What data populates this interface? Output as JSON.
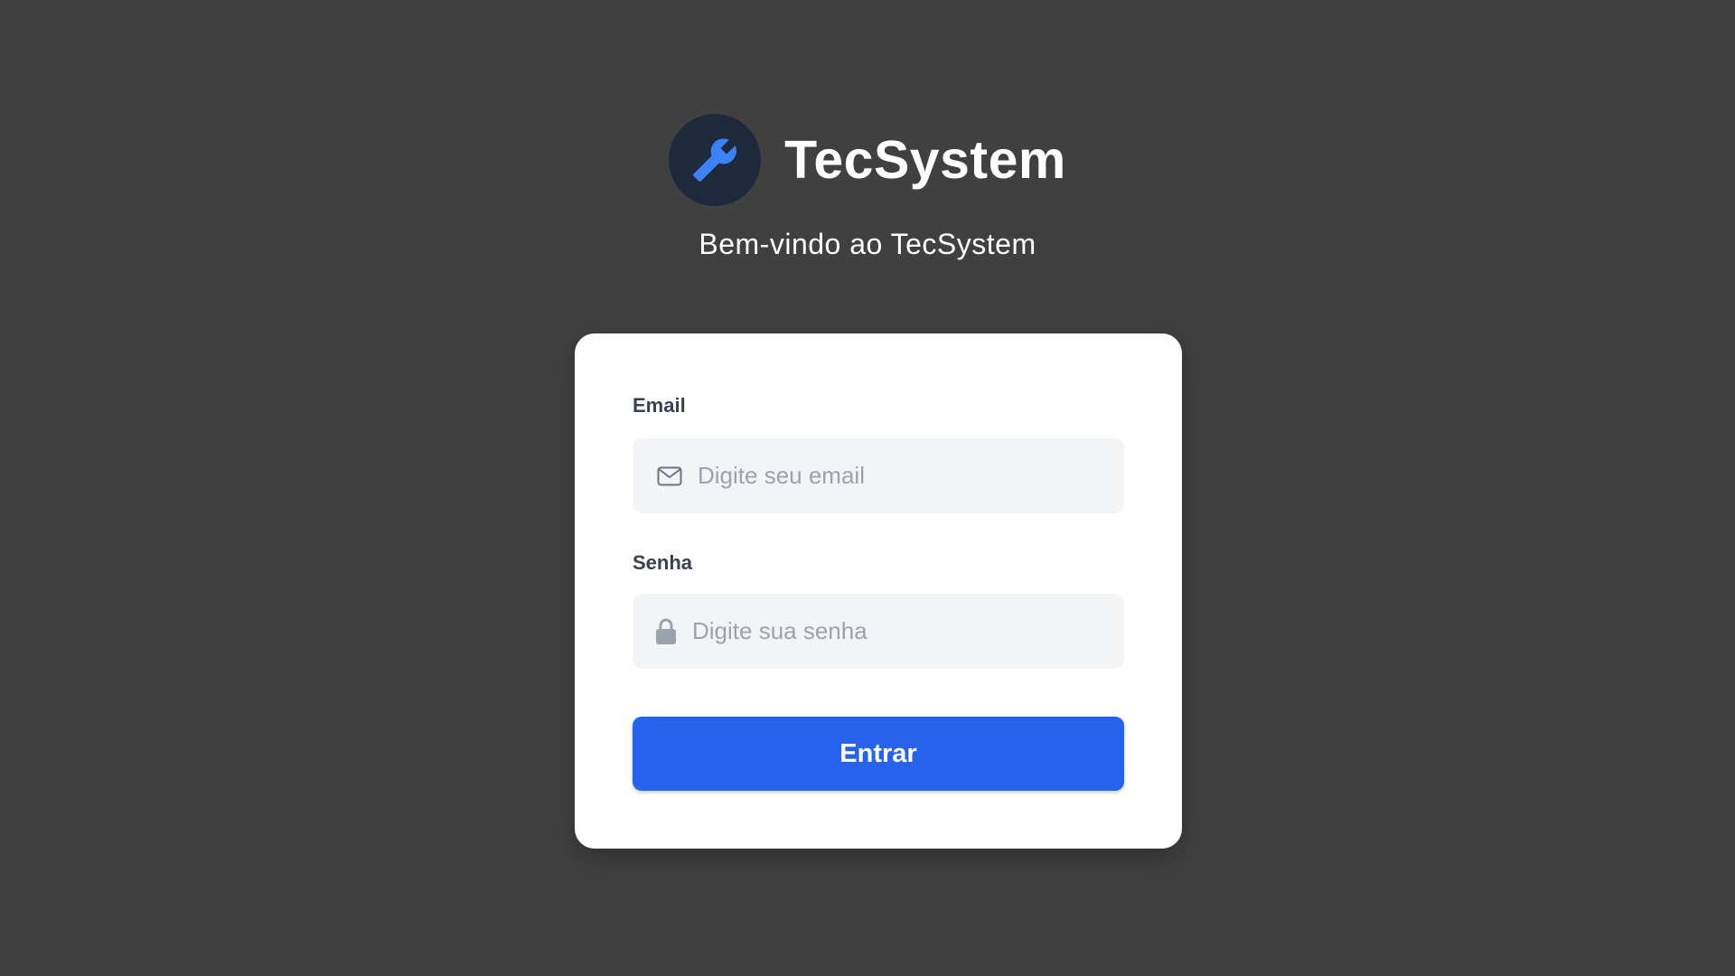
{
  "brand": {
    "name": "TecSystem",
    "logo_icon": "wrench-icon",
    "logo_bg_color": "#1e293b",
    "logo_icon_color": "#3b82f6"
  },
  "subtitle": "Bem-vindo ao TecSystem",
  "login_form": {
    "email": {
      "label": "Email",
      "placeholder": "Digite seu email",
      "value": "",
      "icon": "mail-icon"
    },
    "password": {
      "label": "Senha",
      "placeholder": "Digite sua senha",
      "value": "",
      "icon": "lock-icon"
    },
    "submit_label": "Entrar"
  },
  "colors": {
    "background": "#404040",
    "card": "#ffffff",
    "input_bg": "#f3f4f6",
    "accent": "#2563eb"
  }
}
